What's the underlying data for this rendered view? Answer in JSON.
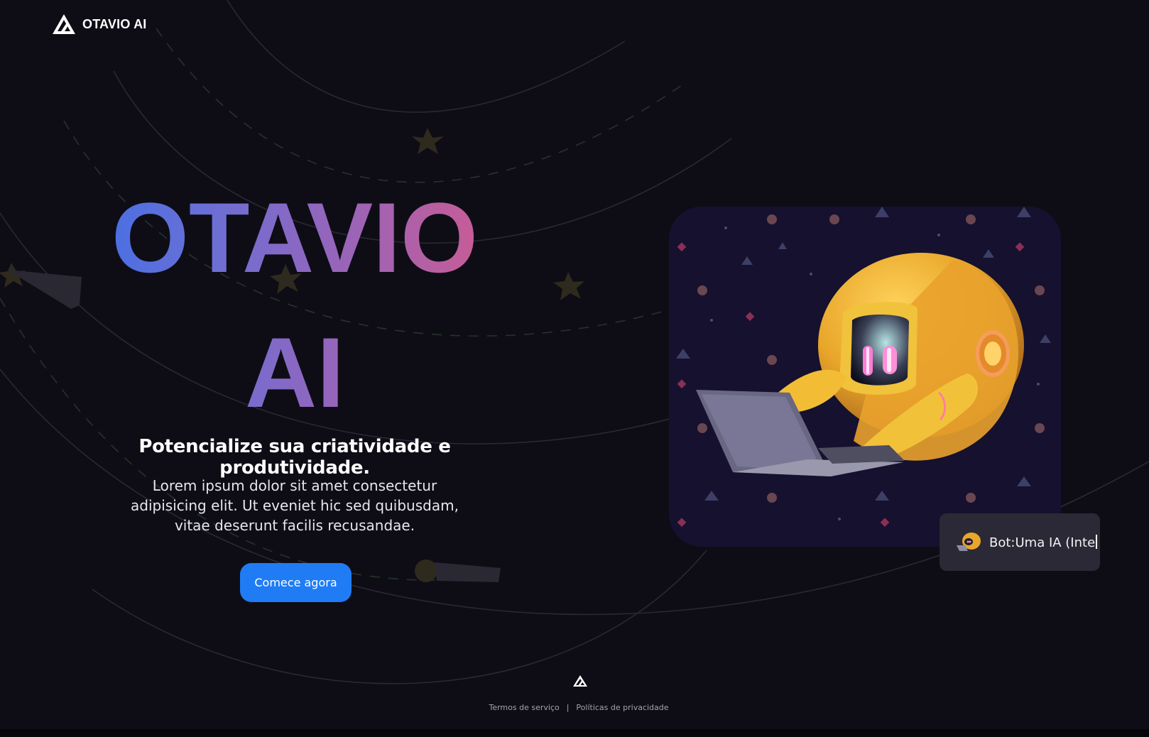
{
  "header": {
    "brand": "OTAVIO AI"
  },
  "hero": {
    "title_line1": "OTAVIO",
    "title_line2": "AI",
    "subtitle": "Potencialize sua criatividade e produtividade.",
    "description": "Lorem ipsum dolor sit amet consectetur adipisicing elit. Ut eveniet hic sed quibusdam, vitae deserunt facilis recusandae.",
    "cta_label": "Comece agora"
  },
  "chat": {
    "text": "Bot:Uma IA (Inte"
  },
  "footer": {
    "terms": "Termos de serviço",
    "separator": "|",
    "privacy": "Políticas de privacidade"
  },
  "colors": {
    "background": "#0e0d16",
    "cta": "#1f7cf5",
    "gradient_start": "#3f6fe6",
    "gradient_end": "#d45a8c",
    "chat_bg": "#2a2935",
    "robot": "#e8a62a"
  },
  "icons": {
    "brand_logo": "triangle-logo-icon",
    "footer_logo": "triangle-logo-icon",
    "chat_avatar": "robot-avatar-icon"
  }
}
